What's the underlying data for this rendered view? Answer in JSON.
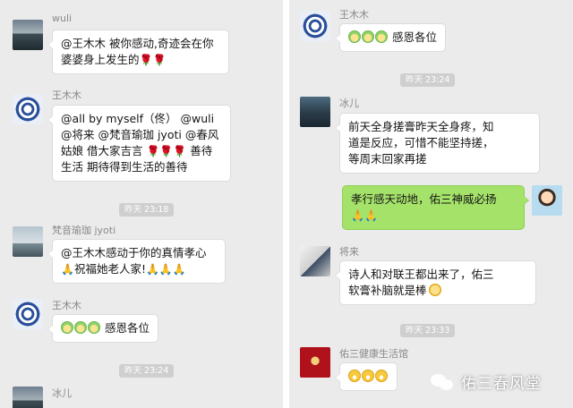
{
  "left": {
    "m1": {
      "name": "wuli",
      "line1": "@王木木 被你感动,奇迹会在你",
      "line2": "婆婆身上发生的",
      "emoji": "🌹🌹"
    },
    "m2": {
      "name": "王木木",
      "line1": "@all by myself（佟） @wuli",
      "line2": "@将来 @梵音瑜珈 jyoti @春风",
      "line3_pre": "姑娘 借大家吉言 ",
      "line3_emoji": "🌹🌹🌹",
      "line3_post": " 善待",
      "line4": "生活 期待得到生活的善待"
    },
    "time1": "昨天 23:18",
    "m3": {
      "name": "梵音瑜珈 jyoti",
      "line1": "@王木木感动于你的真情孝心",
      "line2_pre": "🙏",
      "line2": "祝福她老人家!",
      "line2_post": "🙏🙏🙏"
    },
    "m4": {
      "name": "王木木",
      "text": "感恩各位"
    },
    "time2": "昨天 23:24",
    "m5": {
      "name": "冰儿"
    }
  },
  "right": {
    "m1": {
      "name": "王木木",
      "text": "感恩各位"
    },
    "time1": "昨天 23:24",
    "m2": {
      "name": "冰儿",
      "line1": "前天全身搓膏昨天全身疼，知",
      "line2": "道是反应，可惜不能坚持搓，",
      "line3": "等周末回家再搓"
    },
    "m3": {
      "line1": "孝行感天动地，佑三神威必扬",
      "line2": "🙏🙏"
    },
    "m4": {
      "name": "将来",
      "line1": "诗人和对联王都出来了，佑三",
      "line2": "软膏补脑就是棒"
    },
    "time2": "昨天 23:33",
    "m5": {
      "name": "佑三健康生活馆"
    }
  },
  "watermark": {
    "text": "佑三春风堂"
  },
  "colors": {
    "chat_bg": "#ebebeb",
    "self_bubble": "#a5e26a",
    "other_bubble": "#ffffff",
    "time_badge": "#cfcfcf"
  }
}
